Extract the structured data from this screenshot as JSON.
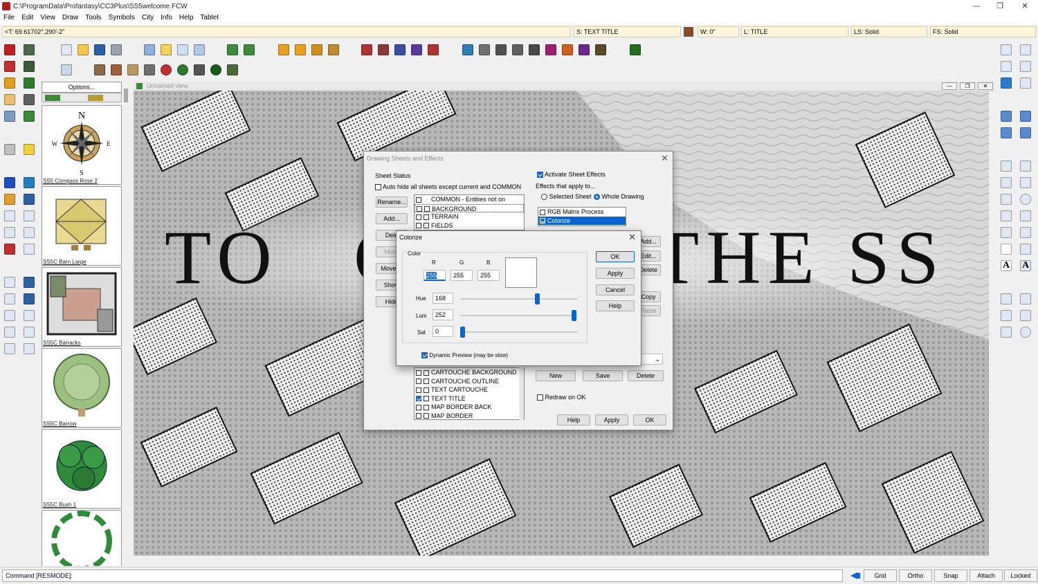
{
  "window": {
    "title": "C:\\ProgramData\\Profantasy\\CC3Plus\\SS5welcome.FCW",
    "minimize": "—",
    "maximize": "❐",
    "close": "✕"
  },
  "menu": [
    "File",
    "Edit",
    "View",
    "Draw",
    "Tools",
    "Symbols",
    "City",
    "Info",
    "Help",
    "Tablet"
  ],
  "status": {
    "coords": "<T: 69.61702°,290'-2\"",
    "sheet": "S: TEXT TITLE",
    "width": "W: 0\"",
    "layer": "L: TITLE",
    "line_style": "LS: Solid",
    "fill_style": "FS: Solid"
  },
  "catalog": {
    "options": "Options...",
    "items": [
      "SS5 Compass Rose 2",
      "SS5C Barn Large",
      "SS5C Barracks",
      "SS5C Barrow",
      "SS5C Bush 1"
    ],
    "compass": {
      "n": "N",
      "s": "S",
      "e": "E",
      "w": "W"
    }
  },
  "view": {
    "title": "Unnamed view"
  },
  "map_text": {
    "left": "TO",
    "left2": "C",
    "right": "THE SS"
  },
  "sheets_dialog": {
    "title": "Drawing Sheets and Effects",
    "sheet_status": "Sheet Status",
    "auto_hide": "Auto hide all sheets except current and COMMON",
    "buttons": [
      "Rename...",
      "Add...",
      "Dele",
      "Move",
      "Move D",
      "Show",
      "Hide"
    ],
    "sheets_top": [
      "COMMON - Entities not on",
      "BACKGROUND",
      "TERRAIN",
      "FIELDS"
    ],
    "sheets_bottom": [
      "CARTOUCHE BACKGROUND",
      "CARTOUCHE OUTLINE",
      "TEXT CARTOUCHE",
      "TEXT TITLE",
      "MAP BORDER BACK",
      "MAP BORDER"
    ],
    "activate": "Activate Sheet Effects",
    "effects_apply": "Effects that apply to...",
    "selected_sheet": "Selected Sheet",
    "whole_drawing": "Whole Drawing",
    "effects": [
      "RGB Matrix Process",
      "Colorize"
    ],
    "side_buttons": [
      "Add...",
      "Edit...",
      "Delete",
      "Copy",
      "Paste"
    ],
    "new": "New",
    "save": "Save",
    "delete": "Delete",
    "redraw": "Redraw on OK",
    "help": "Help",
    "apply": "Apply",
    "ok": "OK"
  },
  "colorize": {
    "title": "Colorize",
    "color": "Color",
    "r_label": "R",
    "g_label": "G",
    "b_label": "B",
    "r": "255",
    "g": "255",
    "b": "255",
    "hue_label": "Hue",
    "hue": "168",
    "lum_label": "Lum",
    "lum": "252",
    "sat_label": "Sat",
    "sat": "0",
    "hue_level": 0.66,
    "lum_level": 0.99,
    "sat_level": 0.0,
    "dynamic": "Dynamic Preview (may be slow)",
    "ok": "OK",
    "apply": "Apply",
    "cancel": "Cancel",
    "help": "Help"
  },
  "command": "Command [RESMODE]:",
  "bottom_buttons": [
    "Grid",
    "Ortho",
    "Snap",
    "Attach",
    "Locked"
  ]
}
